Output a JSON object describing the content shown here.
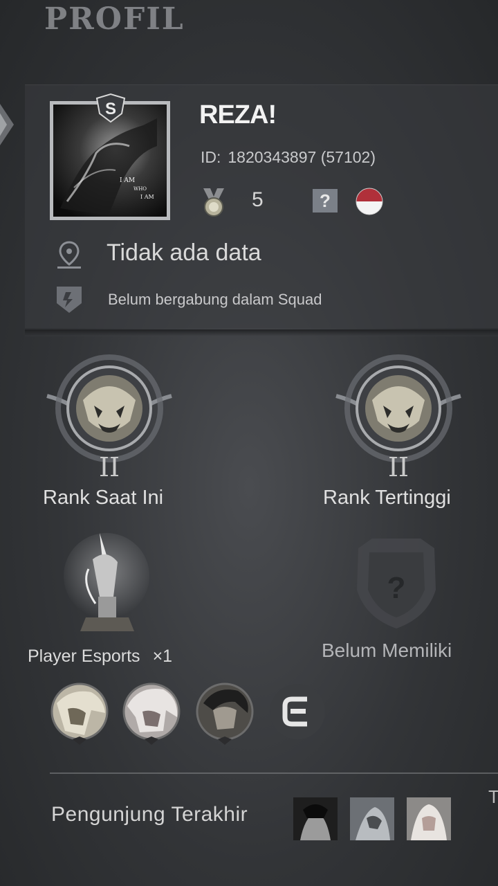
{
  "header": {
    "title": "PROFIL"
  },
  "profile": {
    "name": "REZA!",
    "id_label": "ID:",
    "id_value": "1820343897 (57102)",
    "avatar_badge": "S",
    "avatar_caption": [
      "I AM",
      "WHO",
      "I AM"
    ],
    "medal_count": "5",
    "unknown_badge": "?",
    "location": "Tidak ada data",
    "squad": "Belum bergabung dalam Squad"
  },
  "ranks": {
    "current": {
      "tier": "II",
      "label": "Rank Saat Ini"
    },
    "highest": {
      "tier": "II",
      "label": "Rank Tertinggi"
    }
  },
  "achievements": {
    "esports_label": "Player Esports",
    "esports_multiplier": "×1",
    "locked_symbol": "?",
    "locked_label": "Belum Memiliki"
  },
  "heroes": [
    {
      "icon": "hero-portrait-1"
    },
    {
      "icon": "hero-portrait-2"
    },
    {
      "icon": "hero-portrait-3"
    }
  ],
  "esports_logo": "esports-logo-icon",
  "visitors": {
    "label": "Pengunjung Terakhir",
    "count_shown": 3,
    "edge_glyph": "T"
  },
  "colors": {
    "background": "#323437",
    "text": "#e6e6e6",
    "accent_silver": "#b8babd",
    "flag_red": "#c8102e"
  }
}
